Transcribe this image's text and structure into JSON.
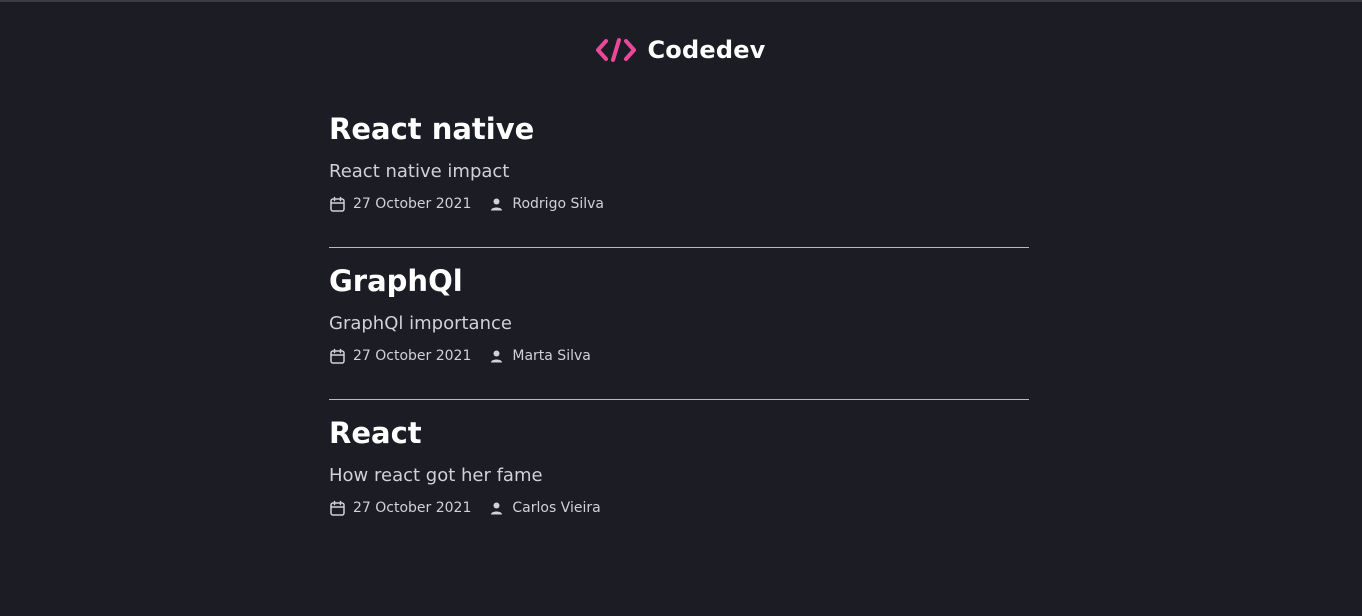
{
  "header": {
    "brand": "Codedev",
    "logo_color": "#ec4899"
  },
  "posts": [
    {
      "title": "React native",
      "subtitle": "React native impact",
      "date": "27 October 2021",
      "author": "Rodrigo Silva"
    },
    {
      "title": "GraphQl",
      "subtitle": "GraphQl importance",
      "date": "27 October 2021",
      "author": "Marta Silva"
    },
    {
      "title": "React",
      "subtitle": "How react got her fame",
      "date": "27 October 2021",
      "author": "Carlos Vieira"
    }
  ],
  "icons": {
    "date": "calendar-icon",
    "author": "user-icon"
  }
}
